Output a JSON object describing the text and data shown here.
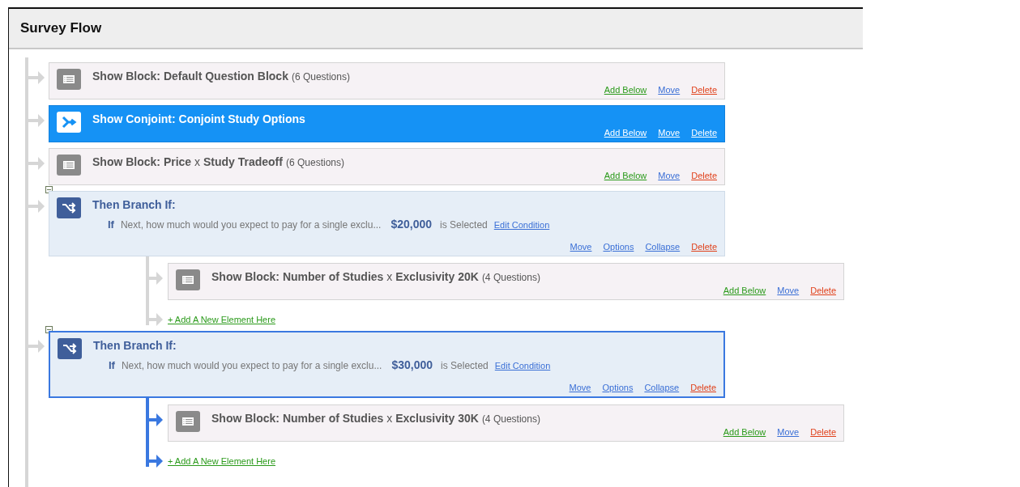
{
  "panel": {
    "title": "Survey Flow"
  },
  "flow": [
    {
      "kind": "block",
      "selected": false,
      "title": [
        "Show Block: Default Question Block"
      ],
      "count": "(6 Questions)",
      "actions": [
        {
          "kind": "add",
          "label": "Add Below"
        },
        {
          "kind": "move",
          "label": "Move"
        },
        {
          "kind": "delete",
          "label": "Delete"
        }
      ]
    },
    {
      "kind": "conjoint",
      "selected": false,
      "title": "Show Conjoint: Conjoint Study Options",
      "actions": [
        {
          "kind": "add",
          "label": "Add Below"
        },
        {
          "kind": "move",
          "label": "Move"
        },
        {
          "kind": "delete",
          "label": "Delete"
        }
      ]
    },
    {
      "kind": "block",
      "selected": false,
      "title": [
        "Show Block: Price",
        "x",
        "Study Tradeoff"
      ],
      "count": "(6 Questions)",
      "actions": [
        {
          "kind": "add",
          "label": "Add Below"
        },
        {
          "kind": "move",
          "label": "Move"
        },
        {
          "kind": "delete",
          "label": "Delete"
        }
      ]
    },
    {
      "kind": "branch",
      "selected": false,
      "expanded": true,
      "title": "Then Branch If:",
      "condition": {
        "keyword": "If",
        "question": "Next, how much would you expect to pay for a single exclu...",
        "answer": "$20,000",
        "operator": "is Selected",
        "link": "Edit Condition"
      },
      "actions": [
        {
          "kind": "move",
          "label": "Move"
        },
        {
          "kind": "options",
          "label": "Options"
        },
        {
          "kind": "collapse",
          "label": "Collapse"
        },
        {
          "kind": "delete",
          "label": "Delete"
        }
      ],
      "children": [
        {
          "kind": "block",
          "selected": false,
          "title": [
            "Show Block: Number of Studies",
            "x",
            "Exclusivity 20K"
          ],
          "count": "(4 Questions)",
          "actions": [
            {
              "kind": "add",
              "label": "Add Below"
            },
            {
              "kind": "move",
              "label": "Move"
            },
            {
              "kind": "delete",
              "label": "Delete"
            }
          ]
        }
      ],
      "add_element": "+ Add A New Element Here"
    },
    {
      "kind": "branch",
      "selected": true,
      "expanded": true,
      "title": "Then Branch If:",
      "condition": {
        "keyword": "If",
        "question": "Next, how much would you expect to pay for a single exclu...",
        "answer": "$30,000",
        "operator": "is Selected",
        "link": "Edit Condition"
      },
      "actions": [
        {
          "kind": "move",
          "label": "Move"
        },
        {
          "kind": "options",
          "label": "Options"
        },
        {
          "kind": "collapse",
          "label": "Collapse"
        },
        {
          "kind": "delete",
          "label": "Delete"
        }
      ],
      "children": [
        {
          "kind": "block",
          "selected": false,
          "title": [
            "Show Block: Number of Studies",
            "x",
            "Exclusivity 30K"
          ],
          "count": "(4 Questions)",
          "actions": [
            {
              "kind": "add",
              "label": "Add Below"
            },
            {
              "kind": "move",
              "label": "Move"
            },
            {
              "kind": "delete",
              "label": "Delete"
            }
          ]
        }
      ],
      "add_element": "+ Add A New Element Here"
    }
  ]
}
